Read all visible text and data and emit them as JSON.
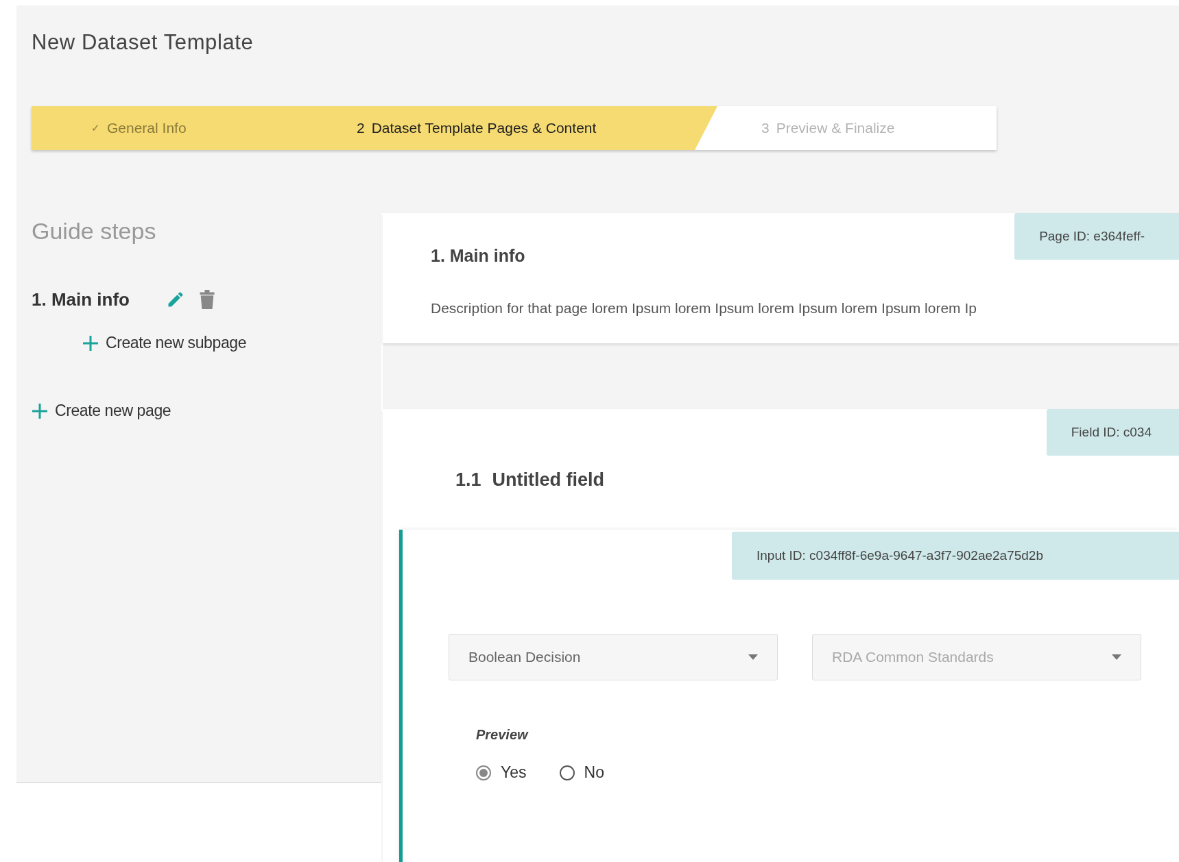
{
  "page": {
    "title": "New Dataset Template"
  },
  "stepper": [
    {
      "marker": "✓",
      "label": "General Info",
      "completed": true,
      "selected": false
    },
    {
      "marker": "2",
      "label": "Dataset Template Pages & Content",
      "completed": false,
      "selected": true
    },
    {
      "marker": "3",
      "label": "Preview & Finalize",
      "completed": false,
      "selected": false
    }
  ],
  "sidebar": {
    "heading": "Guide steps",
    "pages": [
      {
        "label": "1. Main info",
        "add_subpage": "Create new subpage"
      }
    ],
    "add_page": "Create new page"
  },
  "page_card": {
    "badge": "Page ID: e364feff-",
    "title": "1. Main info",
    "description": "Description for that page lorem Ipsum lorem Ipsum lorem Ipsum lorem Ipsum lorem Ip"
  },
  "field_card": {
    "badge": "Field ID: c034",
    "number": "1.1",
    "title": "Untitled field",
    "input": {
      "badge": "Input ID: c034ff8f-6e9a-9647-a3f7-902ae2a75d2b",
      "selects": [
        {
          "value": "Boolean Decision"
        },
        {
          "placeholder": "RDA Common Standards"
        }
      ],
      "preview_label": "Preview",
      "options": [
        {
          "label": "Yes",
          "selected": true
        },
        {
          "label": "No",
          "selected": false
        }
      ]
    }
  }
}
